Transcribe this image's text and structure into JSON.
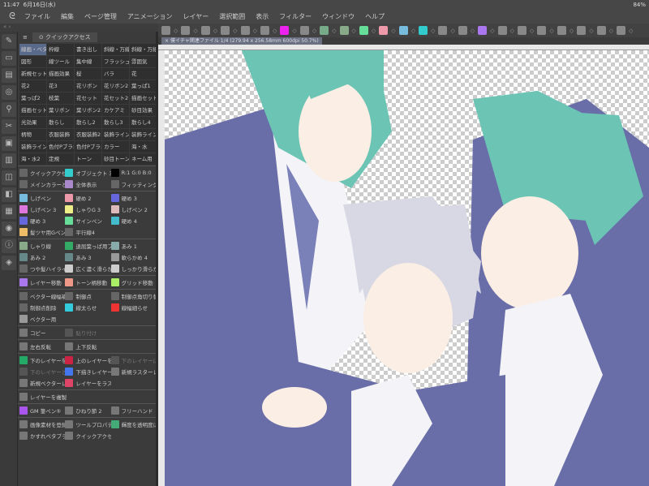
{
  "status": {
    "time": "11:47",
    "date": "6月16日(水)",
    "battery": "84%"
  },
  "menu": [
    "ファイル",
    "編集",
    "ページ管理",
    "アニメーション",
    "レイヤー",
    "選択範囲",
    "表示",
    "フィルター",
    "ウィンドウ",
    "ヘルプ"
  ],
  "panel": {
    "title": "クイックアクセス",
    "collapse": "«  ‹"
  },
  "grid": [
    "線画・ベタ",
    "枠線",
    "書き出し",
    "斜線・万線",
    "斜線・万紙",
    "図形",
    "線ツール",
    "集中線",
    "フラッシュ",
    "雰囲気",
    "新規セット",
    "描画効果",
    "桜",
    "バラ",
    "花",
    "花2",
    "花3",
    "花リボン",
    "花リボン2",
    "葉っぱ1",
    "葉っぱ2",
    "枝葉",
    "花セット",
    "花セット2",
    "描画セット",
    "描画セット:",
    "葉リボン",
    "葉リボン2",
    "カケアミ",
    "砂目効果",
    "光効果",
    "散らし",
    "散らし2",
    "散らし3",
    "散らし4",
    "柄物",
    "衣服装飾",
    "衣服装飾2",
    "装飾ライン",
    "装飾ライン",
    "装飾ライン",
    "色付Pブラ:",
    "色付Pブラ:",
    "カラー",
    "海・水",
    "海・水2",
    "定規",
    "トーン",
    "砂目トーン",
    "ネーム用"
  ],
  "sections": [
    [
      {
        "l": "クイックアクセス",
        "c": "#666"
      },
      {
        "l": "オブジェクト 3",
        "c": "#3cc"
      },
      {
        "l": "R:1 G:0 B:0",
        "c": "#000"
      },
      {
        "l": "メインカラーとり",
        "c": "#666"
      },
      {
        "l": "全体表示",
        "c": "#a8c"
      },
      {
        "l": "フィッティング",
        "c": "#666"
      }
    ],
    [
      {
        "l": "しげペン",
        "c": "#7bd"
      },
      {
        "l": "硬め 2",
        "c": "#e9a"
      },
      {
        "l": "硬め 3",
        "c": "#66d"
      },
      {
        "l": "しげペン 3",
        "c": "#d7d"
      },
      {
        "l": "しゃりG 3",
        "c": "#ee8"
      },
      {
        "l": "しげペン 2",
        "c": "#dbb"
      },
      {
        "l": "硬め 3",
        "c": "#66d"
      },
      {
        "l": "サインペン",
        "c": "#6d9"
      },
      {
        "l": "硬め 4",
        "c": "#4bc"
      },
      {
        "l": "髪ツヤ用Gペン",
        "c": "#eb6"
      },
      {
        "l": "平行線4",
        "c": "#666"
      }
    ],
    [
      {
        "l": "しゃり線",
        "c": "#8a8"
      },
      {
        "l": "退屈葉っぱ用ブラ",
        "c": "#3a6"
      },
      {
        "l": "あみ 1",
        "c": "#8aa"
      },
      {
        "l": "あみ 2",
        "c": "#688"
      },
      {
        "l": "あみ 3",
        "c": "#688"
      },
      {
        "l": "軟らかめ 4",
        "c": "#999"
      },
      {
        "l": "つや髪ハイライト",
        "c": "#666"
      },
      {
        "l": "広く濃く滑らか削",
        "c": "#ccc"
      },
      {
        "l": "しっかり滑らか削",
        "c": "#ccc"
      }
    ],
    [
      {
        "l": "レイヤー移動",
        "c": "#a7e"
      },
      {
        "l": "トーン柄移動",
        "c": "#e98"
      },
      {
        "l": "グリッド移動",
        "c": "#ae6"
      }
    ],
    [
      {
        "l": "ベクター線幅補正",
        "c": "#666"
      },
      {
        "l": "制御点",
        "c": "#666"
      },
      {
        "l": "制御点角切り替え",
        "c": "#666"
      },
      {
        "l": "制御点削除",
        "c": "#666"
      },
      {
        "l": "線太らせ",
        "c": "#3cd"
      },
      {
        "l": "線幅細らせ",
        "c": "#e33"
      },
      {
        "l": "ベクター用",
        "c": "#999"
      }
    ],
    [
      {
        "l": "コピー",
        "c": "#777"
      },
      {
        "l": "貼り付け",
        "c": "#555",
        "d": true
      }
    ],
    [
      {
        "l": "左右反転",
        "c": "#777"
      },
      {
        "l": "上下反転",
        "c": "#777"
      }
    ],
    [
      {
        "l": "下のレイヤーを結",
        "c": "#2a6"
      },
      {
        "l": "上のレイヤーを結",
        "c": "#c24"
      },
      {
        "l": "下のレイヤーに結",
        "c": "#555",
        "d": true
      },
      {
        "l": "下のレイヤーと結",
        "c": "#555",
        "d": true
      },
      {
        "l": "下描きレイヤーに",
        "c": "#47e"
      },
      {
        "l": "新規ラスターレイ",
        "c": "#777"
      },
      {
        "l": "新規ベクターレイ",
        "c": "#777"
      },
      {
        "l": "レイヤーをラスタ",
        "c": "#d46"
      }
    ],
    [
      {
        "l": "レイヤーを複製",
        "c": "#777"
      }
    ],
    [
      {
        "l": "GM 筆ペン⑤",
        "c": "#a5e"
      },
      {
        "l": "ひねり節 2",
        "c": "#777"
      },
      {
        "l": "フリーハンド",
        "c": "#777"
      }
    ],
    [
      {
        "l": "画像素材を登録",
        "c": "#777"
      },
      {
        "l": "ツールプロパティ",
        "c": "#777"
      },
      {
        "l": "輝度を透明度に変",
        "c": "#4a7"
      },
      {
        "l": "かすれベタブラシ",
        "c": "#777"
      },
      {
        "l": "クイックアクセス",
        "c": "#777"
      }
    ]
  ],
  "document": {
    "tab": "僕イチャ関連ファイル 1/4 (279.94 x 256.58mm 600dpi 50.7%)"
  },
  "colors": {
    "hair": "#6cc4b4",
    "jacket": "#6a6ea8",
    "silver": "#d8d8e4"
  }
}
